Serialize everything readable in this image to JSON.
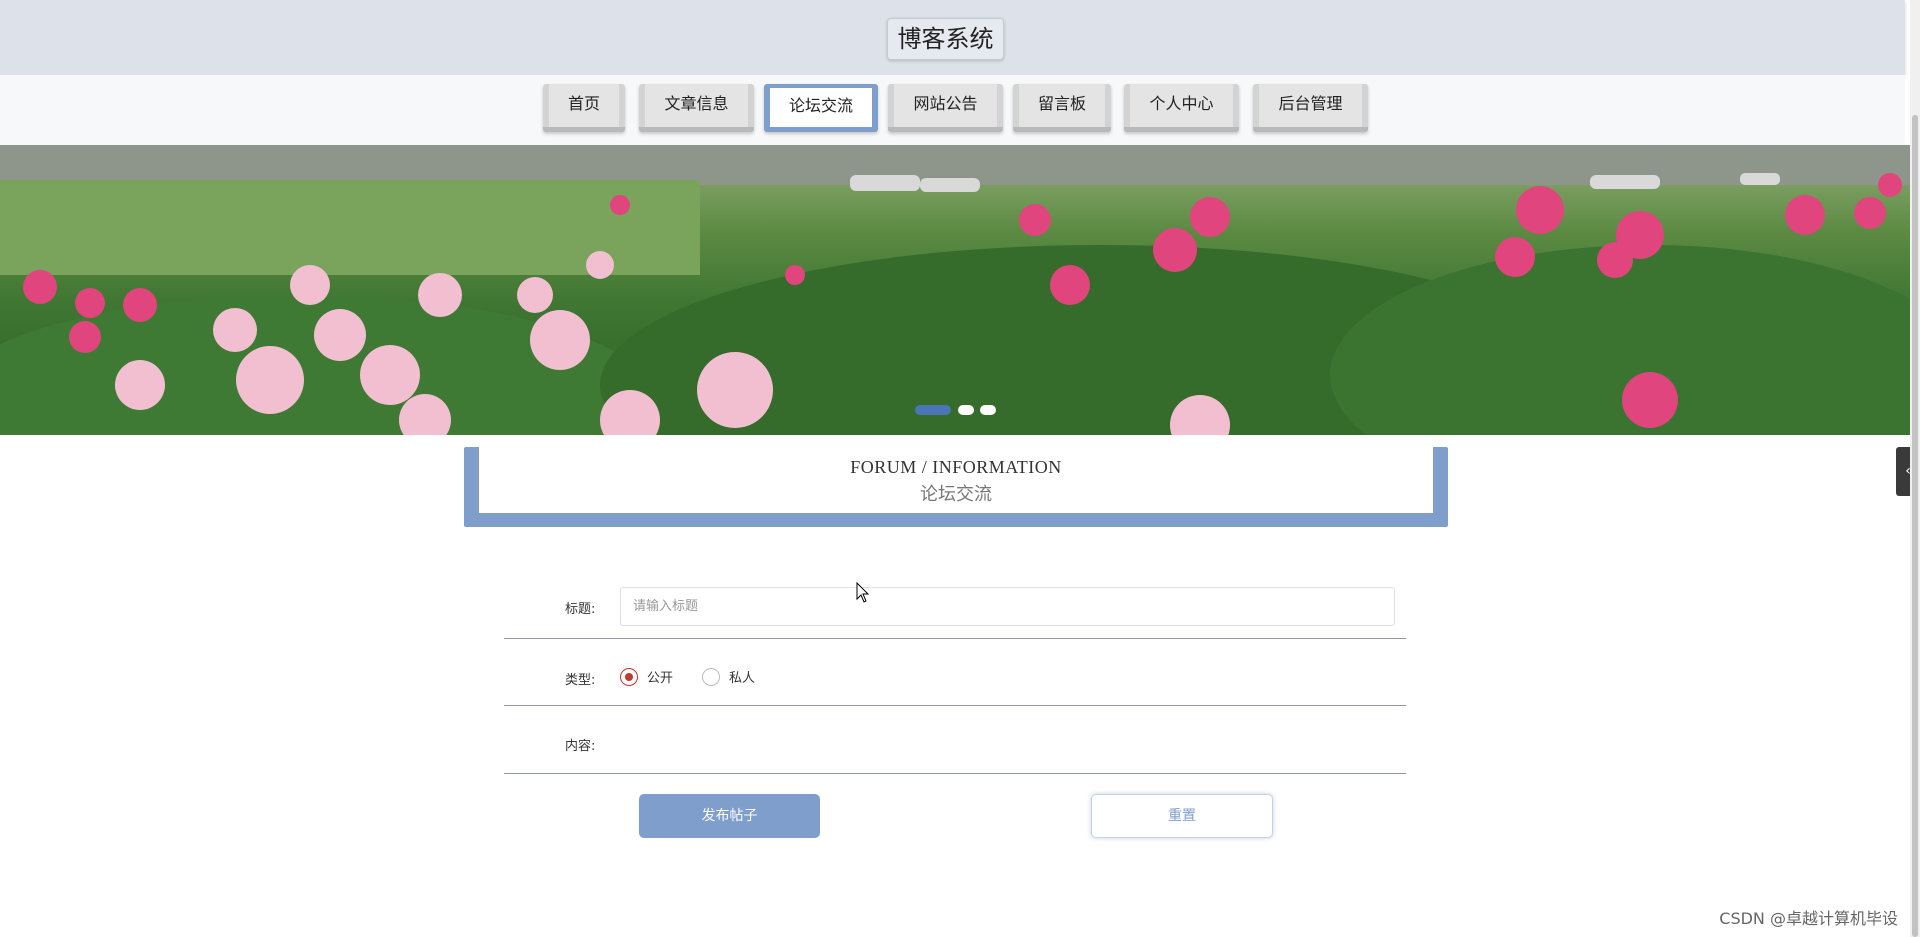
{
  "header": {
    "title": "博客系统"
  },
  "nav": {
    "items": [
      {
        "label": "首页",
        "active": false
      },
      {
        "label": "文章信息",
        "active": false
      },
      {
        "label": "论坛交流",
        "active": true
      },
      {
        "label": "网站公告",
        "active": false
      },
      {
        "label": "留言板",
        "active": false
      },
      {
        "label": "个人中心",
        "active": false
      },
      {
        "label": "后台管理",
        "active": false
      }
    ]
  },
  "banner": {
    "slides": 3,
    "active_slide": 1
  },
  "section": {
    "title_en": "FORUM / INFORMATION",
    "title_cn": "论坛交流"
  },
  "form": {
    "title_label": "标题:",
    "title_placeholder": "请输入标题",
    "type_label": "类型:",
    "type_options": [
      {
        "label": "公开",
        "checked": true
      },
      {
        "label": "私人",
        "checked": false
      }
    ],
    "content_label": "内容:",
    "submit_label": "发布帖子",
    "reset_label": "重置"
  },
  "colors": {
    "accent": "#7f9ecb",
    "radio_checked": "#c0392b",
    "header_bg": "#dde2ea"
  },
  "side_tab": {
    "icon": "chevron-left-icon",
    "glyph": "‹"
  },
  "watermark": "CSDN @卓越计算机毕设"
}
